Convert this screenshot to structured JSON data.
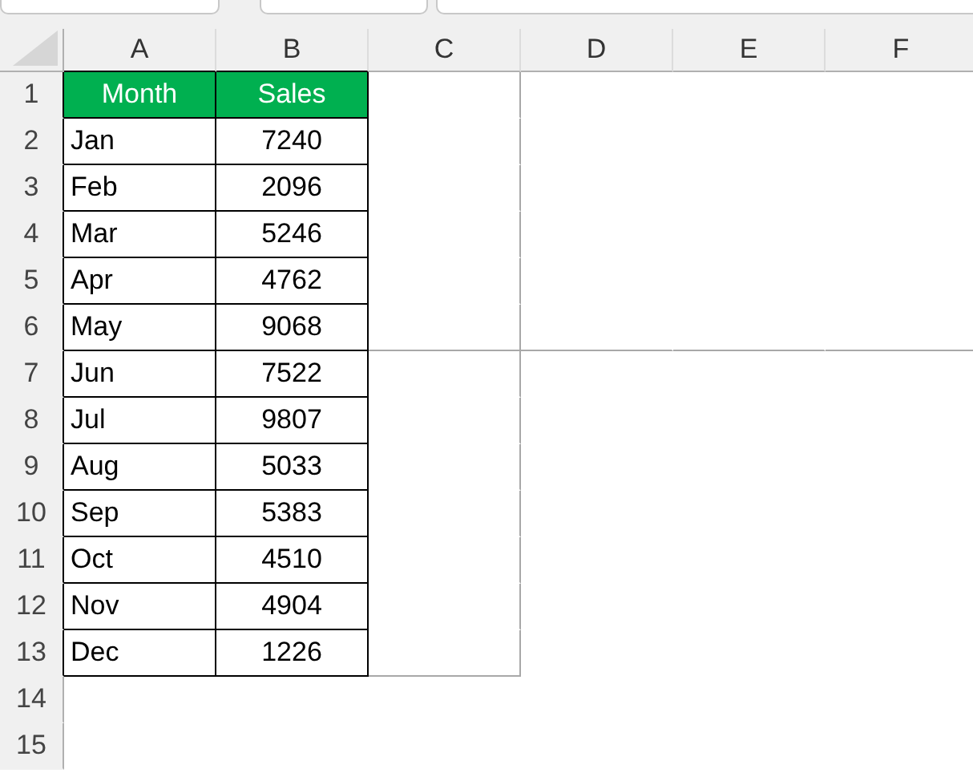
{
  "column_headers": [
    "A",
    "B",
    "C",
    "D",
    "E",
    "F"
  ],
  "rows": [
    {
      "number": "1",
      "kind": "header",
      "cells": [
        "Month",
        "Sales"
      ]
    },
    {
      "number": "2",
      "kind": "data",
      "cells": [
        "Jan",
        "7240"
      ]
    },
    {
      "number": "3",
      "kind": "data",
      "cells": [
        "Feb",
        "2096"
      ]
    },
    {
      "number": "4",
      "kind": "data",
      "cells": [
        "Mar",
        "5246"
      ]
    },
    {
      "number": "5",
      "kind": "data",
      "cells": [
        "Apr",
        "4762"
      ]
    },
    {
      "number": "6",
      "kind": "data",
      "cells": [
        "May",
        "9068"
      ]
    },
    {
      "number": "7",
      "kind": "data",
      "cells": [
        "Jun",
        "7522"
      ]
    },
    {
      "number": "8",
      "kind": "data",
      "cells": [
        "Jul",
        "9807"
      ]
    },
    {
      "number": "9",
      "kind": "data",
      "cells": [
        "Aug",
        "5033"
      ]
    },
    {
      "number": "10",
      "kind": "data",
      "cells": [
        "Sep",
        "5383"
      ]
    },
    {
      "number": "11",
      "kind": "data",
      "cells": [
        "Oct",
        "4510"
      ]
    },
    {
      "number": "12",
      "kind": "data",
      "cells": [
        "Nov",
        "4904"
      ]
    },
    {
      "number": "13",
      "kind": "data",
      "cells": [
        "Dec",
        "1226"
      ]
    },
    {
      "number": "14",
      "kind": "empty"
    },
    {
      "number": "15",
      "kind": "empty"
    }
  ]
}
